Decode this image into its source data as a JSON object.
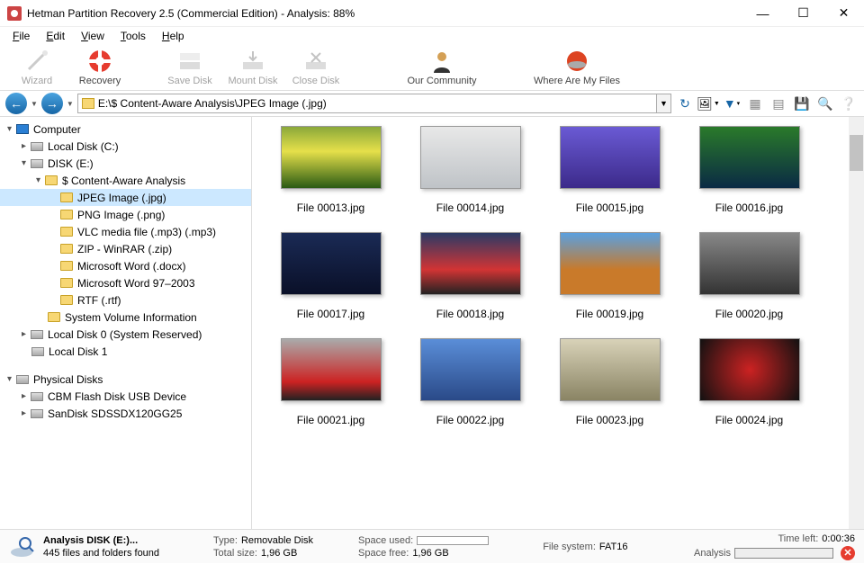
{
  "title": "Hetman Partition Recovery 2.5 (Commercial Edition) - Analysis: 88%",
  "menu": [
    "File",
    "Edit",
    "View",
    "Tools",
    "Help"
  ],
  "toolbar": {
    "wizard": "Wizard",
    "recovery": "Recovery",
    "save_disk": "Save Disk",
    "mount_disk": "Mount Disk",
    "close_disk": "Close Disk",
    "community": "Our Community",
    "where_files": "Where Are My Files"
  },
  "address": "E:\\$ Content-Aware Analysis\\JPEG Image (.jpg)",
  "tree": {
    "root": "Computer",
    "local_c": "Local Disk (C:)",
    "disk_e": "DISK (E:)",
    "content_aware": "$ Content-Aware Analysis",
    "jpeg": "JPEG Image (.jpg)",
    "png": "PNG Image (.png)",
    "vlc": "VLC media file (.mp3) (.mp3)",
    "zip": "ZIP - WinRAR (.zip)",
    "docx": "Microsoft Word (.docx)",
    "doc": "Microsoft Word 97–2003",
    "rtf": "RTF (.rtf)",
    "svi": "System Volume Information",
    "local0": "Local Disk 0 (System Reserved)",
    "local1": "Local Disk 1",
    "physical": "Physical Disks",
    "cbm": "CBM Flash Disk USB Device",
    "sandisk": "SanDisk SDSSDX120GG25"
  },
  "files": [
    {
      "name": "File 00013.jpg",
      "cls": "t1"
    },
    {
      "name": "File 00014.jpg",
      "cls": "t2"
    },
    {
      "name": "File 00015.jpg",
      "cls": "t3"
    },
    {
      "name": "File 00016.jpg",
      "cls": "t4"
    },
    {
      "name": "File 00017.jpg",
      "cls": "t5"
    },
    {
      "name": "File 00018.jpg",
      "cls": "t6"
    },
    {
      "name": "File 00019.jpg",
      "cls": "t7"
    },
    {
      "name": "File 00020.jpg",
      "cls": "t8"
    },
    {
      "name": "File 00021.jpg",
      "cls": "t9"
    },
    {
      "name": "File 00022.jpg",
      "cls": "t10"
    },
    {
      "name": "File 00023.jpg",
      "cls": "t11"
    },
    {
      "name": "File 00024.jpg",
      "cls": "t12"
    }
  ],
  "status": {
    "analysis_title": "Analysis DISK (E:)...",
    "found": "445 files and folders found",
    "type_lbl": "Type:",
    "type_val": "Removable Disk",
    "total_lbl": "Total size:",
    "total_val": "1,96 GB",
    "used_lbl": "Space used:",
    "free_lbl": "Space free:",
    "free_val": "1,96 GB",
    "fs_lbl": "File system:",
    "fs_val": "FAT16",
    "time_lbl": "Time left:",
    "time_val": "0:00:36",
    "analysis_lbl": "Analysis"
  }
}
